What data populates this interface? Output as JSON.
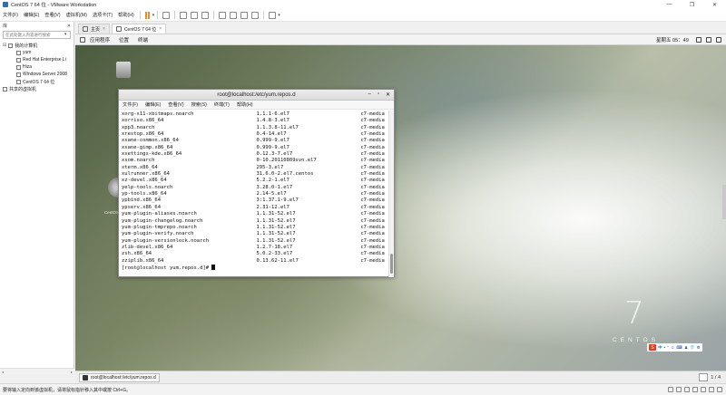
{
  "window": {
    "title": "CentOS 7 64 位 - VMware Workstation",
    "controls": [
      "—",
      "❐",
      "✕"
    ]
  },
  "menubar": {
    "items": [
      "文件(F)",
      "编辑(E)",
      "查看(V)",
      "虚拟机(M)",
      "选项卡(T)",
      "帮助(H)"
    ],
    "dropdown_glyph": "▾"
  },
  "library": {
    "header_label": "库",
    "close_glyph": "✕",
    "search_placeholder": "在此处键入内容进行搜索",
    "search_dropdown_glyph": "▾",
    "root_label": "我的计算机",
    "vms": [
      "yum",
      "Red Hat Enterprise Li",
      "Hiza",
      "Windows Server 2008",
      "CentOS 7 64 位"
    ],
    "shared_label": "共享的虚拟机",
    "expand_glyph": "⊟",
    "scroll_left": "◂",
    "scroll_right": "▸"
  },
  "tabs": [
    {
      "label": "主页",
      "active": false
    },
    {
      "label": "CentOS 7 64 位",
      "active": true
    }
  ],
  "tab_close_glyph": "×",
  "gnome_top": {
    "applications": "应用程序",
    "places": "位置",
    "terminal": "终端",
    "clock": "星期五 05：49"
  },
  "terminal": {
    "title": "root@localhost:/etc/yum.repos.d",
    "controls": [
      "–",
      "▫",
      "✕"
    ],
    "menu": [
      "文件(F)",
      "编辑(E)",
      "查看(V)",
      "搜索(S)",
      "终端(T)",
      "帮助(H)"
    ],
    "rows": [
      [
        "xorg-x11-xbitmaps.noarch",
        "1.1.1-6.el7",
        "c7-media"
      ],
      [
        "xorriso.x86_64",
        "1.4.8-3.el7",
        "c7-media"
      ],
      [
        "xpp3.noarch",
        "1.1.3.8-11.el7",
        "c7-media"
      ],
      [
        "xrestop.x86_64",
        "0.4-14.el7",
        "c7-media"
      ],
      [
        "xsane-common.x86_64",
        "0.999-9.el7",
        "c7-media"
      ],
      [
        "xsane-gimp.x86_64",
        "0.999-9.el7",
        "c7-media"
      ],
      [
        "xsettings-kde.x86_64",
        "0.12.3-7.el7",
        "c7-media"
      ],
      [
        "xsom.noarch",
        "0-10.20110809svn.el7",
        "c7-media"
      ],
      [
        "xterm.x86_64",
        "295-3.el7",
        "c7-media"
      ],
      [
        "xulrunner.x86_64",
        "31.6.0-2.el7.centos",
        "c7-media"
      ],
      [
        "xz-devel.x86_64",
        "5.2.2-1.el7",
        "c7-media"
      ],
      [
        "yelp-tools.noarch",
        "3.28.0-1.el7",
        "c7-media"
      ],
      [
        "yp-tools.x86_64",
        "2.14-5.el7",
        "c7-media"
      ],
      [
        "ypbind.x86_64",
        "3:1.37.1-9.el7",
        "c7-media"
      ],
      [
        "ypserv.x86_64",
        "2.31-12.el7",
        "c7-media"
      ],
      [
        "yum-plugin-aliases.noarch",
        "1.1.31-52.el7",
        "c7-media"
      ],
      [
        "yum-plugin-changelog.noarch",
        "1.1.31-52.el7",
        "c7-media"
      ],
      [
        "yum-plugin-tmprepo.noarch",
        "1.1.31-52.el7",
        "c7-media"
      ],
      [
        "yum-plugin-verify.noarch",
        "1.1.31-52.el7",
        "c7-media"
      ],
      [
        "yum-plugin-versionlock.noarch",
        "1.1.31-52.el7",
        "c7-media"
      ],
      [
        "zlib-devel.x86_64",
        "1.2.7-18.el7",
        "c7-media"
      ],
      [
        "zsh.x86_64",
        "5.0.2-33.el7",
        "c7-media"
      ],
      [
        "zziplib.x86_64",
        "0.13.62-11.el7",
        "c7-media"
      ]
    ],
    "prompt": "[root@localhost yum.repos.d]# "
  },
  "desktop": {
    "disc_label": "CentOS 7 x86_64",
    "brand_numeral": "7",
    "brand_text": "CENTOS"
  },
  "ime": {
    "logo": "S",
    "items": [
      "中",
      "•",
      "°",
      "☺",
      "⌨",
      "♟",
      "👕",
      "⚙"
    ]
  },
  "taskbar": {
    "task_label": "root@localhost:/etc/yum.repos.d",
    "pager": "1 / 4"
  },
  "statusbar": {
    "message": "要将输入定向到该虚拟机，请将鼠标指针移入其中或按 Ctrl+G。"
  },
  "colors": {
    "pause_orange": "#f08a24",
    "ime_red": "#e63b1f"
  }
}
